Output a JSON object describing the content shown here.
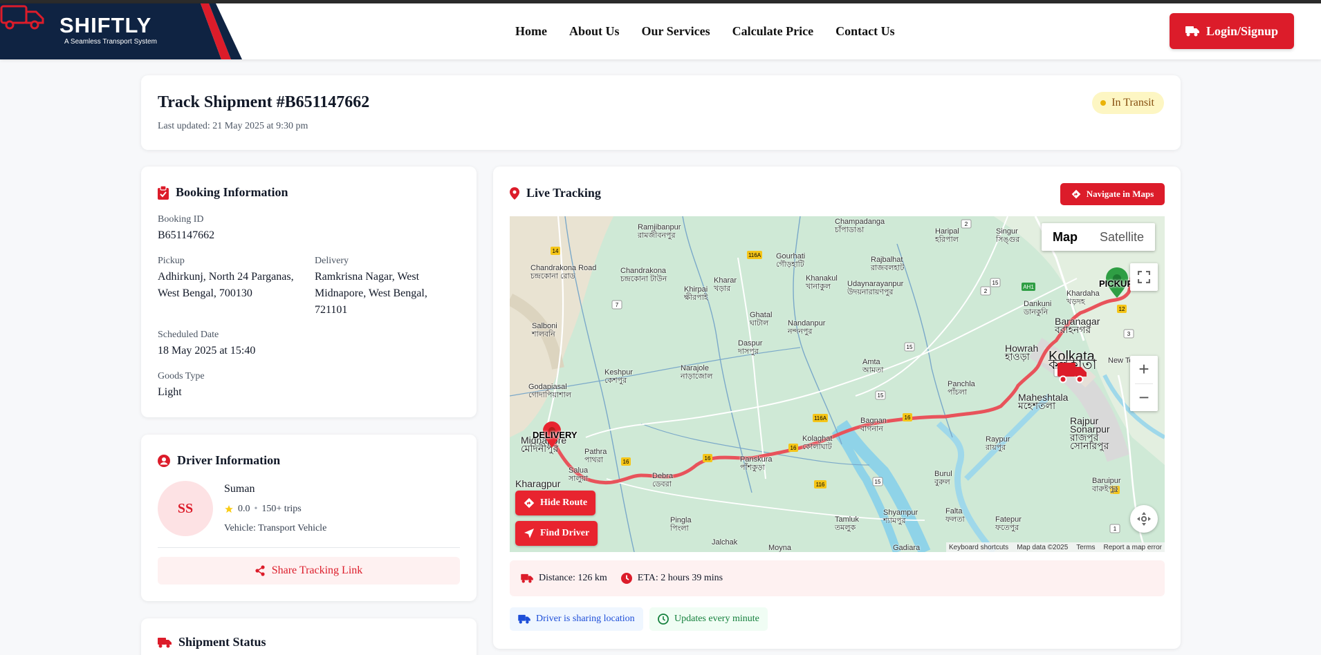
{
  "brand": {
    "name": "SHIFTLY",
    "tagline": "A Seamless Transport System"
  },
  "nav": [
    "Home",
    "About Us",
    "Our Services",
    "Calculate Price",
    "Contact Us"
  ],
  "login_label": "Login/Signup",
  "shipment": {
    "title": "Track Shipment #B651147662",
    "last_updated": "Last updated: 21 May 2025 at 9:30 pm",
    "status": "In Transit"
  },
  "booking": {
    "heading": "Booking Information",
    "booking_id_label": "Booking ID",
    "booking_id": "B651147662",
    "pickup_label": "Pickup",
    "pickup_line1": "Adhirkunj, North 24 Parganas,",
    "pickup_line2": "West Bengal, 700130",
    "delivery_label": "Delivery",
    "delivery_line1": "Ramkrisna Nagar, West",
    "delivery_line2": "Midnapore, West Bengal,",
    "delivery_line3": "721101",
    "scheduled_label": "Scheduled Date",
    "scheduled": "18 May 2025 at 15:40",
    "goods_label": "Goods Type",
    "goods": "Light"
  },
  "driver": {
    "heading": "Driver Information",
    "initials": "SS",
    "name": "Suman",
    "rating": "0.0",
    "trips": "150+ trips",
    "vehicle": "Vehicle: Transport Vehicle",
    "share_label": "Share Tracking Link"
  },
  "shipment_status": {
    "heading": "Shipment Status"
  },
  "tracking": {
    "heading": "Live Tracking",
    "navigate_label": "Navigate in Maps",
    "map": {
      "type_map": "Map",
      "type_satellite": "Satellite",
      "pickup_label": "PICKUP",
      "delivery_label": "DELIVERY",
      "hide_route": "Hide Route",
      "find_driver": "Find Driver",
      "zoom_in": "+",
      "zoom_out": "−",
      "footer": [
        "Keyboard shortcuts",
        "Map data ©2025",
        "Terms",
        "Report a map error"
      ],
      "cities": [
        {
          "en": "Champadanga",
          "bn": "চাঁপাডাঙা"
        },
        {
          "en": "Ramjibanpur",
          "bn": "রামজীবনপুর"
        },
        {
          "en": "Haripal",
          "bn": "হরিপাল"
        },
        {
          "en": "Singur",
          "bn": "সিঙ্গুর"
        },
        {
          "en": "Chandrakona Road",
          "bn": "চন্দ্রকোনা রোড"
        },
        {
          "en": "Chandrakona",
          "bn": "চন্দ্রকোনা টাউন"
        },
        {
          "en": "Gourhati",
          "bn": "গৌড়হাটি"
        },
        {
          "en": "Rajbalhat",
          "bn": "রাজবলহাট"
        },
        {
          "en": "Kharar",
          "bn": "খড়ার"
        },
        {
          "en": "Khirpai",
          "bn": "ক্ষীরপাই"
        },
        {
          "en": "Khanakul",
          "bn": "খানাকুল"
        },
        {
          "en": "Udaynarayanpur",
          "bn": "উদয়নারায়ণপুর"
        },
        {
          "en": "Dankuni",
          "bn": "ডানকুনি"
        },
        {
          "en": "Khardaha",
          "bn": "খড়দহ"
        },
        {
          "en": "Baranagar",
          "bn": "বরাহনগর"
        },
        {
          "en": "Salboni",
          "bn": "শালবনি"
        },
        {
          "en": "Ghatal",
          "bn": "ঘাটাল"
        },
        {
          "en": "Nandanpur",
          "bn": "নন্দনপুর"
        },
        {
          "en": "Daspur",
          "bn": "দাসপুর"
        },
        {
          "en": "Amta",
          "bn": "আমতা"
        },
        {
          "en": "Howrah",
          "bn": "হাওড়া"
        },
        {
          "en": "Kolkata",
          "bn": "কলকাতা"
        },
        {
          "en": "New Town",
          "bn": ""
        },
        {
          "en": "Keshpur",
          "bn": "কেশপুর"
        },
        {
          "en": "Narajole",
          "bn": "নাড়াজোল"
        },
        {
          "en": "Panchla",
          "bn": "পাঁচলা"
        },
        {
          "en": "Maheshtala",
          "bn": "মহেশতলা"
        },
        {
          "en": "Godapiasal",
          "bn": "গোদাপিয়াশাল"
        },
        {
          "en": "Bagnan",
          "bn": "বাগনান"
        },
        {
          "en": "Rajpur Sonarpur",
          "bn": "রাজপুর সোনারপুর"
        },
        {
          "en": "Midnapore",
          "bn": "মেদিনীপুর"
        },
        {
          "en": "Pathra",
          "bn": "পাথরা"
        },
        {
          "en": "Kolaghat",
          "bn": "কোলাঘাট"
        },
        {
          "en": "Raypur",
          "bn": "রায়পুর"
        },
        {
          "en": "Salua",
          "bn": "সালুয়া"
        },
        {
          "en": "Debra",
          "bn": "ডেবরা"
        },
        {
          "en": "Panskura",
          "bn": "পাঁশকুড়া"
        },
        {
          "en": "Kharagpur",
          "bn": ""
        },
        {
          "en": "Burul",
          "bn": "বুরুল"
        },
        {
          "en": "Baruipur",
          "bn": "বারুইপুর"
        },
        {
          "en": "Shyampur",
          "bn": "শ্যামপুর"
        },
        {
          "en": "Pingla",
          "bn": "পিংলা"
        },
        {
          "en": "Tamluk",
          "bn": "তমলুক"
        },
        {
          "en": "Falta",
          "bn": "ফলতা"
        },
        {
          "en": "Fatepur",
          "bn": "ফতেপুর"
        },
        {
          "en": "Jalchak",
          "bn": "জলচক"
        },
        {
          "en": "Moyna",
          "bn": ""
        },
        {
          "en": "Gadiara",
          "bn": ""
        }
      ],
      "road_shields": [
        "14",
        "7",
        "116A",
        "2",
        "15",
        "AH1",
        "12",
        "3",
        "6",
        "116",
        "1",
        "2",
        "16"
      ]
    },
    "distance": "Distance: 126 km",
    "eta": "ETA: 2 hours 39 mins",
    "sharing": "Driver is sharing location",
    "updates": "Updates every minute"
  },
  "colors": {
    "brand_red": "#dc1c2a",
    "navy": "#0f2342",
    "route": "#e8535b",
    "pickup_green": "#2f9e44"
  },
  "icons": [
    "clipboard-check-icon",
    "user-circle-icon",
    "truck-icon",
    "map-pin-icon",
    "diamond-direction-icon",
    "location-arrow-icon",
    "share-icon",
    "star-icon",
    "clock-icon",
    "fullscreen-icon",
    "pan-control-icon"
  ]
}
